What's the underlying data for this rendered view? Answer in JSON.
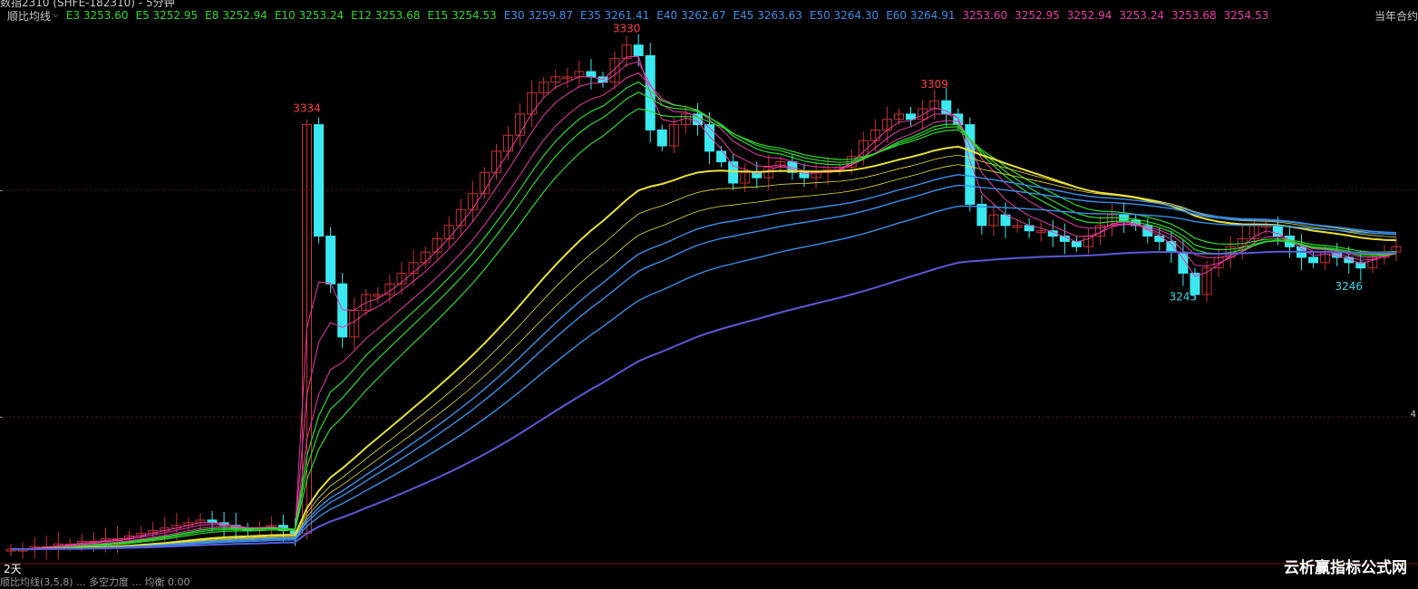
{
  "header": {
    "truncated_title": "数指2310 (SHFE-182310) - 5分钟",
    "indicator_name": "顺比均线",
    "right_label": "当年合约"
  },
  "legend": [
    {
      "label": "E3 3253.60",
      "color": "#2ed82e"
    },
    {
      "label": "E5 3252.95",
      "color": "#2ed82e"
    },
    {
      "label": "E8 3252.94",
      "color": "#2ed82e"
    },
    {
      "label": "E10 3253.24",
      "color": "#2ed82e"
    },
    {
      "label": "E12 3253.68",
      "color": "#2ed82e"
    },
    {
      "label": "E15 3254.53",
      "color": "#2ed82e"
    },
    {
      "label": "E30 3259.87",
      "color": "#3a8fe8"
    },
    {
      "label": "E35 3261.41",
      "color": "#3a8fe8"
    },
    {
      "label": "E40 3262.67",
      "color": "#3a8fe8"
    },
    {
      "label": "E45 3263.63",
      "color": "#3a8fe8"
    },
    {
      "label": "E50 3264.30",
      "color": "#3a8fe8"
    },
    {
      "label": "E60 3264.91",
      "color": "#3a8fe8"
    },
    {
      "label": "3253.60",
      "color": "#e83aa8"
    },
    {
      "label": "3252.95",
      "color": "#e83aa8"
    },
    {
      "label": "3252.94",
      "color": "#e83aa8"
    },
    {
      "label": "3253.24",
      "color": "#e83aa8"
    },
    {
      "label": "3253.68",
      "color": "#e83aa8"
    },
    {
      "label": "3254.53",
      "color": "#e83aa8"
    }
  ],
  "annotations": [
    {
      "text": "3334",
      "color": "#ff4040"
    },
    {
      "text": "3330",
      "color": "#ff4040"
    },
    {
      "text": "3309",
      "color": "#ff4040"
    },
    {
      "text": "3245",
      "color": "#3ad8e8"
    },
    {
      "text": "3246",
      "color": "#3ad8e8"
    }
  ],
  "footer": {
    "period_label": "2天",
    "bottom_text": "顺比均线(3,5,8)  ...  多空力度  ...  均衡 0.00",
    "watermark": "云析赢指标公式网",
    "right_edge": "4"
  },
  "colors": {
    "up_candle": "#c83232",
    "down_candle": "#3ae8f0",
    "short_ema": "#2ed82e",
    "long_ema": "#3a8fe8",
    "pink_ema": "#e83aa8",
    "yellow_ema": "#e8e03a",
    "base_line": "#5a5ad8"
  }
}
